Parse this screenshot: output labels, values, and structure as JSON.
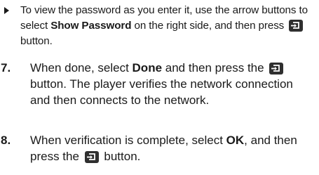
{
  "bullet": {
    "pre": "To view the password as you enter it, use the arrow buttons to select ",
    "bold": "Show Password",
    "mid": " on the right side, and then press ",
    "post": " button."
  },
  "steps": [
    {
      "number": "7.",
      "pre": "When done, select ",
      "bold": "Done",
      "mid": " and then press the ",
      "post": " button. The player verifies the network connection and then connects to the network."
    },
    {
      "number": "8.",
      "pre": "When verification is complete, select ",
      "bold": "OK",
      "mid": ", and then press the ",
      "post": " button."
    }
  ],
  "icons": {
    "bullet_marker": "triangle-bullet-icon",
    "enter_button": "enter-button-icon"
  },
  "colors": {
    "text": "#1a1a1a",
    "icon_background": "#2f2f2f"
  }
}
